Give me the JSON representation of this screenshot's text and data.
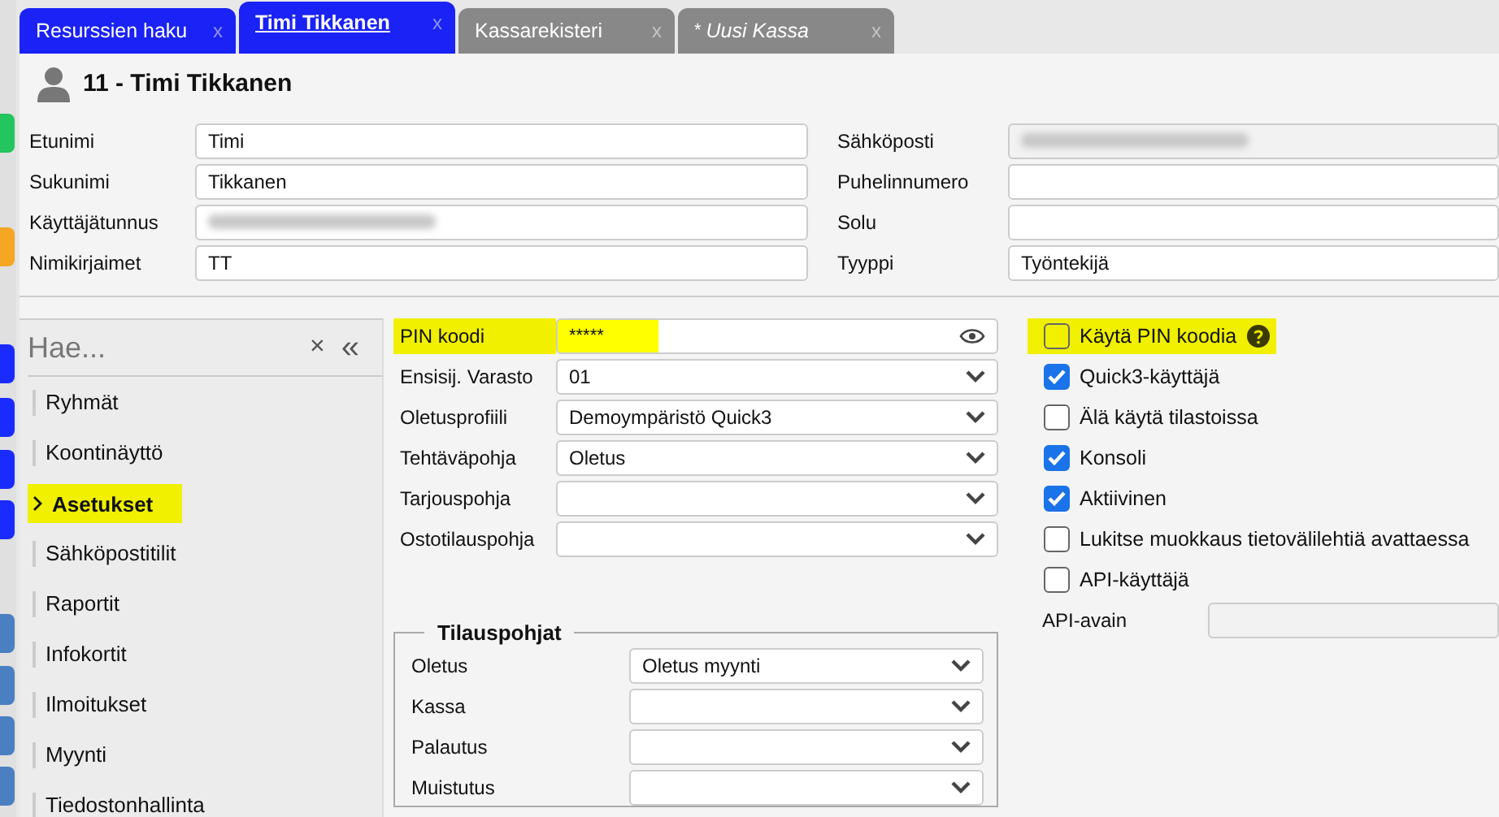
{
  "rail": [
    {
      "color": "#22c55e"
    },
    {
      "color": "#f5a623"
    },
    {
      "color": "#1a2bff"
    },
    {
      "color": "#1a2bff"
    },
    {
      "color": "#1a2bff"
    },
    {
      "color": "#1a2bff"
    },
    {
      "color": "#4a7fc1"
    },
    {
      "color": "#4a7fc1"
    },
    {
      "color": "#4a7fc1"
    },
    {
      "color": "#4a7fc1"
    }
  ],
  "tabs": [
    {
      "label": "Resurssien haku",
      "close": "x",
      "selected": false,
      "kind": "blue"
    },
    {
      "label": "Timi Tikkanen",
      "close": "x",
      "selected": true,
      "kind": "blue"
    },
    {
      "label": "Kassarekisteri",
      "close": "x",
      "selected": false,
      "kind": "grey"
    },
    {
      "label": "Uusi Kassa",
      "close": "x",
      "selected": false,
      "kind": "grey",
      "marker": "*"
    }
  ],
  "header": {
    "title": "11 - Timi Tikkanen"
  },
  "basic_left": [
    {
      "label": "Etunimi",
      "value": "Timi"
    },
    {
      "label": "Sukunimi",
      "value": "Tikkanen"
    },
    {
      "label": "Käyttäjätunnus",
      "redacted": true
    },
    {
      "label": "Nimikirjaimet",
      "value": "TT"
    }
  ],
  "basic_right": [
    {
      "label": "Sähköposti",
      "redacted": true
    },
    {
      "label": "Puhelinnumero"
    },
    {
      "label": "Solu"
    },
    {
      "label": "Tyyppi",
      "value": "Työntekijä"
    }
  ],
  "sidebar": {
    "search": {
      "placeholder": "Hae..."
    },
    "clear": "×",
    "collapse": "«",
    "items": [
      {
        "label": "Ryhmät",
        "selected": false
      },
      {
        "label": "Koontinäyttö",
        "selected": false
      },
      {
        "label": "Asetukset",
        "selected": true
      },
      {
        "label": "Sähköpostitilit",
        "selected": false
      },
      {
        "label": "Raportit",
        "selected": false
      },
      {
        "label": "Infokortit",
        "selected": false
      },
      {
        "label": "Ilmoitukset",
        "selected": false
      },
      {
        "label": "Myynti",
        "selected": false
      },
      {
        "label": "Tiedostonhallinta",
        "selected": false
      }
    ]
  },
  "settings": [
    {
      "label": "PIN koodi",
      "value": "*****",
      "kind": "password",
      "highlighted": true
    },
    {
      "label": "Ensisij. Varasto",
      "value": "01",
      "kind": "select",
      "highlighted": false
    },
    {
      "label": "Oletusprofiili",
      "value": "Demoympäristö Quick3",
      "kind": "select",
      "highlighted": false
    },
    {
      "label": "Tehtäväpohja",
      "value": "Oletus",
      "kind": "select",
      "highlighted": false
    },
    {
      "label": "Tarjouspohja",
      "kind": "select",
      "highlighted": false
    },
    {
      "label": "Ostotilauspohja",
      "kind": "select",
      "highlighted": false
    }
  ],
  "order_templates": {
    "title": "Tilauspohjat",
    "fields": [
      {
        "label": "Oletus",
        "value": "Oletus myynti"
      },
      {
        "label": "Kassa"
      },
      {
        "label": "Palautus"
      },
      {
        "label": "Muistutus"
      }
    ]
  },
  "options": [
    {
      "label": "Käytä PIN koodia",
      "checked": false,
      "highlighted": true,
      "help": true
    },
    {
      "label": "Quick3-käyttäjä",
      "checked": true,
      "highlighted": false
    },
    {
      "label": "Älä käytä tilastoissa",
      "checked": false,
      "highlighted": false
    },
    {
      "label": "Konsoli",
      "checked": true,
      "highlighted": false
    },
    {
      "label": "Aktiivinen",
      "checked": true,
      "highlighted": false
    },
    {
      "label": "Lukitse muokkaus tietovälilehtiä avattaessa",
      "checked": false,
      "highlighted": false
    },
    {
      "label": "API-käyttäjä",
      "checked": false,
      "highlighted": false
    }
  ],
  "api_key": {
    "label": "API-avain"
  }
}
